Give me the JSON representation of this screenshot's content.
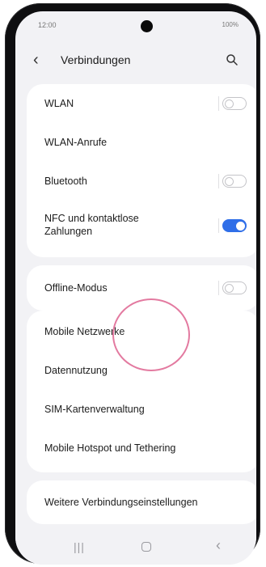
{
  "status_bar": {
    "time": "12:00",
    "indicators": "100%"
  },
  "header": {
    "title": "Verbindungen",
    "back_icon": "chevron-left-icon",
    "search_icon": "search-icon"
  },
  "connections": [
    {
      "label": "WLAN",
      "toggle": false
    },
    {
      "label": "WLAN-Anrufe"
    },
    {
      "label": "Bluetooth",
      "toggle": false
    },
    {
      "label": "NFC und kontaktlose Zahlungen",
      "toggle": true
    }
  ],
  "offline": {
    "label": "Offline-Modus",
    "toggle": false
  },
  "networks": [
    {
      "label": "Mobile Netzwerke"
    },
    {
      "label": "Datennutzung"
    },
    {
      "label": "SIM-Kartenverwaltung"
    },
    {
      "label": "Mobile Hotspot und Tethering"
    }
  ],
  "more": {
    "label": "Weitere Verbindungseinstellungen"
  },
  "colors": {
    "toggle_on": "#2f6ee8",
    "tap_indicator": "#e37aa0",
    "background": "#f2f2f5"
  },
  "navbar": {
    "recent_icon": "recent-apps-icon",
    "home_icon": "home-icon",
    "back_icon": "back-icon"
  }
}
